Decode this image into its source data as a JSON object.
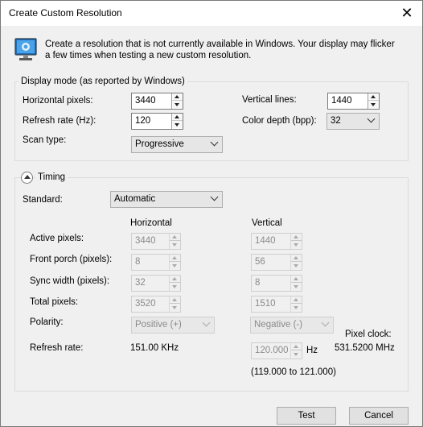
{
  "window": {
    "title": "Create Custom Resolution",
    "close_label": "✕"
  },
  "intro": {
    "text": "Create a resolution that is not currently available in Windows. Your display may flicker a few times when testing a new custom resolution."
  },
  "display_mode": {
    "legend": "Display mode (as reported by Windows)",
    "horizontal_pixels": {
      "label": "Horizontal pixels:",
      "value": "3440"
    },
    "vertical_lines": {
      "label": "Vertical lines:",
      "value": "1440"
    },
    "refresh_rate": {
      "label": "Refresh rate (Hz):",
      "value": "120"
    },
    "color_depth": {
      "label": "Color depth (bpp):",
      "value": "32"
    },
    "scan_type": {
      "label": "Scan type:",
      "value": "Progressive"
    }
  },
  "timing": {
    "legend": "Timing",
    "standard": {
      "label": "Standard:",
      "value": "Automatic"
    },
    "col_horizontal": "Horizontal",
    "col_vertical": "Vertical",
    "active_pixels": {
      "label": "Active pixels:",
      "h": "3440",
      "v": "1440"
    },
    "front_porch": {
      "label": "Front porch (pixels):",
      "h": "8",
      "v": "56"
    },
    "sync_width": {
      "label": "Sync width (pixels):",
      "h": "32",
      "v": "8"
    },
    "total_pixels": {
      "label": "Total pixels:",
      "h": "3520",
      "v": "1510"
    },
    "polarity": {
      "label": "Polarity:",
      "h": "Positive (+)",
      "v": "Negative (-)"
    },
    "refresh_rate": {
      "label": "Refresh rate:",
      "h": "151.00 KHz",
      "v": "120.000",
      "v_unit": "Hz",
      "range": "(119.000 to 121.000)"
    },
    "pixel_clock": {
      "label": "Pixel clock:",
      "value": "531.5200 MHz"
    }
  },
  "buttons": {
    "test": "Test",
    "cancel": "Cancel"
  }
}
